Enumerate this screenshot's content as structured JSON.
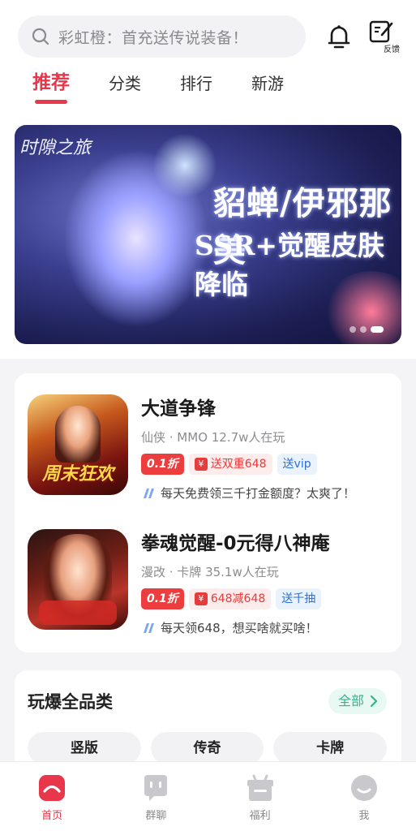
{
  "search": {
    "placeholder_text": "彩虹橙：首充送传说装备！"
  },
  "header": {
    "feedback_label": "反馈"
  },
  "tabs": [
    {
      "label": "推荐",
      "active": true
    },
    {
      "label": "分类",
      "active": false
    },
    {
      "label": "排行",
      "active": false
    },
    {
      "label": "新游",
      "active": false
    }
  ],
  "banner": {
    "game_logo": "时隙之旅",
    "headline": "貂蝉/伊邪那美",
    "subline": "SSR+觉醒皮肤降临",
    "slide_count": 3,
    "active_slide": 3
  },
  "games": [
    {
      "title": "大道争锋",
      "meta": "仙侠 · MMO  12.7w人在玩",
      "discount": "0.1折",
      "rebate": "送双重648",
      "gift": "送vip",
      "slogan": "每天免费领三千打金额度？太爽了！",
      "icon_caption": "周末狂欢"
    },
    {
      "title": "拳魂觉醒-0元得八神庵",
      "meta": "漫改 · 卡牌  35.1w人在玩",
      "discount": "0.1折",
      "rebate": "648减648",
      "gift": "送千抽",
      "slogan": "每天领648，想买啥就买啥！",
      "icon_caption": ""
    }
  ],
  "categories": {
    "title": "玩爆全品类",
    "all_label": "全部",
    "chips": [
      "竖版",
      "传奇",
      "卡牌"
    ]
  },
  "bottom_nav": [
    {
      "label": "首页",
      "icon": "home-icon",
      "active": true
    },
    {
      "label": "群聊",
      "icon": "chat-icon",
      "active": false
    },
    {
      "label": "福利",
      "icon": "gift-icon",
      "active": false
    },
    {
      "label": "我",
      "icon": "profile-icon",
      "active": false
    }
  ],
  "colors": {
    "accent": "#e8374a",
    "green": "#33b58a",
    "blue_tag": "#2e6fd8"
  }
}
